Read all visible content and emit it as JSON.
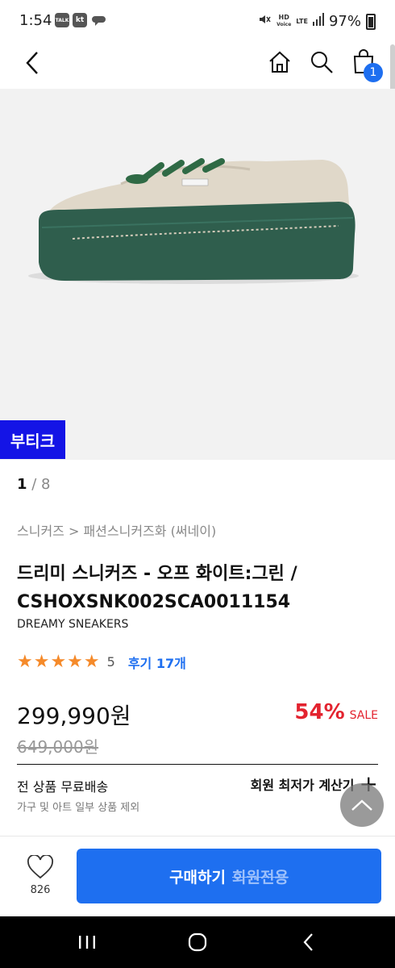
{
  "status_bar": {
    "time": "1:54",
    "notif_icons": [
      "TALK",
      "kt",
      "cloud"
    ],
    "volte": "HD",
    "volte_sub": "Voice",
    "network": "LTE",
    "battery": "97%"
  },
  "header": {
    "cart_count": "1"
  },
  "gallery": {
    "store_tag": "부티크",
    "current": "1",
    "total": "/ 8"
  },
  "product": {
    "breadcrumb": "스니커즈 > 패션스니커즈화 (써네이)",
    "title_line1": "드리미 스니커즈 - 오프 화이트:그린 /",
    "title_line2": "CSHOXSNK002SCA0011154",
    "brand": "DREAMY SNEAKERS",
    "stars": "★★★★★",
    "rating": "5",
    "reviews": "후기 17개",
    "price": "299,990원",
    "discount_pct": "54%",
    "discount_label": "SALE",
    "original_price": "649,000원"
  },
  "shipping": {
    "title": "전 상품 무료배송",
    "subtitle": "가구 및 아트 일부 상품 제외",
    "member_price": "회원 최저가 계산기"
  },
  "bottom_bar": {
    "like_count": "826",
    "buy_label": "구매하기",
    "buy_sub": "회원전용"
  },
  "colors": {
    "accent": "#1e6ff0",
    "sale_red": "#e3232f",
    "store_tag": "#1414e6",
    "star": "#f58a2a"
  }
}
